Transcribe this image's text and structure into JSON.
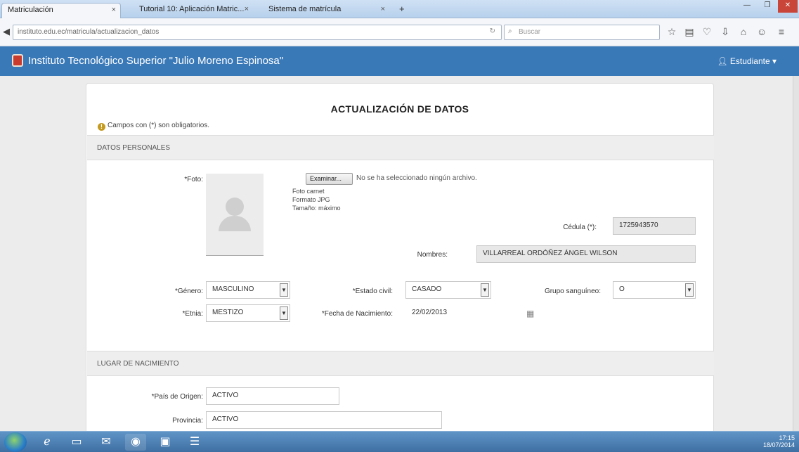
{
  "browser": {
    "tabs": [
      {
        "label": "Matriculación",
        "active": true
      },
      {
        "label": "Tutorial 10: Aplicación Matric...",
        "active": false
      },
      {
        "label": "Sistema de matrícula",
        "active": false
      }
    ],
    "new_tab": "+",
    "url": "instituto.edu.ec/matricula/actualizacion_datos",
    "search_placeholder": "Buscar",
    "window_controls": [
      "—",
      "❐",
      "✕"
    ]
  },
  "site": {
    "title": "Instituto Tecnológico Superior \"Julio Moreno Espinosa\"",
    "user_menu": "Estudiante ▾"
  },
  "form": {
    "title": "ACTUALIZACIÓN DE DATOS",
    "required_note": "Campos con (*) son obligatorios.",
    "sections": {
      "personal": "DATOS PERSONALES",
      "birth": "LUGAR DE NACIMIENTO"
    },
    "photo": {
      "label": "*Foto:",
      "button": "Examinar...",
      "file_text": "No se ha seleccionado ningún archivo.",
      "hints": [
        "Foto carnet",
        "Formato JPG",
        "Tamaño: máximo"
      ]
    },
    "cedula": {
      "label": "Cédula (*):",
      "value": "1725943570"
    },
    "nombres": {
      "label": "Nombres:",
      "value": "VILLARREAL ORDÓÑEZ ÁNGEL WILSON"
    },
    "genero": {
      "label": "*Género:",
      "value": "MASCULINO"
    },
    "estado_civil": {
      "label": "*Estado civil:",
      "value": "CASADO"
    },
    "grupo_sanguineo": {
      "label": "Grupo sanguíneo:",
      "value": "O"
    },
    "etnia": {
      "label": "*Etnia:",
      "value": "MESTIZO"
    },
    "fecha_nacimiento": {
      "label": "*Fecha de Nacimiento:",
      "value": "22/02/2013"
    },
    "pais": {
      "label": "*País de Origen:",
      "value": "ACTIVO"
    },
    "provincia": {
      "label": "Provincia:",
      "value": "ACTIVO"
    }
  },
  "taskbar": {
    "clock_time": "17:15",
    "clock_date": "18/07/2014"
  }
}
